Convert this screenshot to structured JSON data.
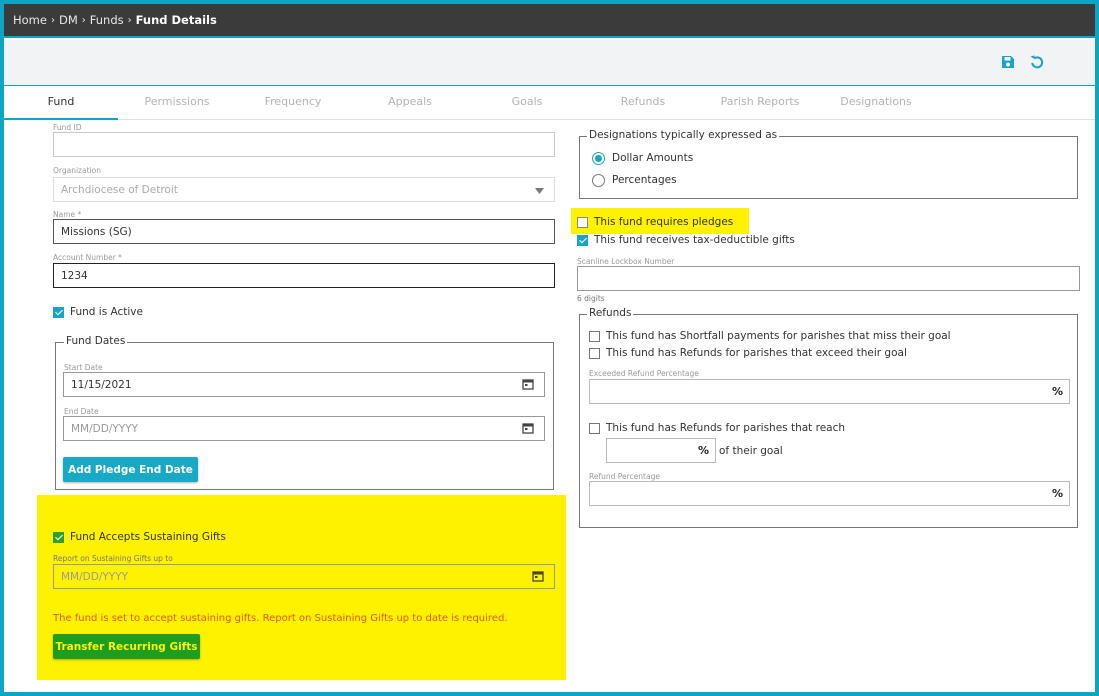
{
  "breadcrumb": {
    "items": [
      "Home",
      "DM",
      "Funds"
    ],
    "current": "Fund Details",
    "separator": "›"
  },
  "toolbar": {
    "save_icon": "save-icon",
    "undo_icon": "undo-icon"
  },
  "tabs": [
    "Fund",
    "Permissions",
    "Frequency",
    "Appeals",
    "Goals",
    "Refunds",
    "Parish Reports",
    "Designations"
  ],
  "left": {
    "fund_id": {
      "label": "Fund ID",
      "value": ""
    },
    "organization": {
      "label": "Organization",
      "value": "Archdiocese of Detroit"
    },
    "name": {
      "label": "Name *",
      "value": "Missions (SG)"
    },
    "account_number": {
      "label": "Account Number *",
      "value": "1234"
    },
    "fund_active": {
      "label": "Fund is Active",
      "checked": true
    },
    "fund_dates": {
      "legend": "Fund Dates",
      "start_label": "Start Date",
      "start_value": "11/15/2021",
      "end_label": "End Date",
      "end_placeholder": "MM/DD/YYYY",
      "add_button": "Add Pledge End Date"
    },
    "sustaining": {
      "label": "Fund Accepts Sustaining Gifts",
      "checked": true,
      "report_label": "Report on Sustaining Gifts up to",
      "report_placeholder": "MM/DD/YYYY",
      "error": "The fund is set to accept sustaining gifts. Report on Sustaining Gifts up to date is required.",
      "transfer_button": "Transfer Recurring Gifts"
    }
  },
  "right": {
    "designations": {
      "legend": "Designations typically expressed as",
      "options": [
        "Dollar Amounts",
        "Percentages"
      ],
      "selected": "Dollar Amounts"
    },
    "requires_pledges": {
      "label": "This fund requires pledges",
      "checked": false
    },
    "tax_deductible": {
      "label": "This fund receives tax-deductible gifts",
      "checked": true
    },
    "scanline": {
      "label": "Scanline Lockbox Number",
      "value": "",
      "hint": "6 digits"
    },
    "refunds": {
      "legend": "Refunds",
      "shortfall": "This fund has Shortfall payments for parishes that miss their goal",
      "exceed": "This fund has Refunds for parishes that exceed their goal",
      "exceeded_pct_label": "Exceeded Refund Percentage",
      "reach": "This fund has Refunds for parishes that reach",
      "of_goal": "of their goal",
      "refund_pct_label": "Refund Percentage",
      "pct_symbol": "%"
    }
  },
  "colors": {
    "accent": "#1aa3c4",
    "button": "#18a9c6",
    "green_button": "#1e9e1e",
    "highlight": "#fff200",
    "error": "#e05a00"
  }
}
